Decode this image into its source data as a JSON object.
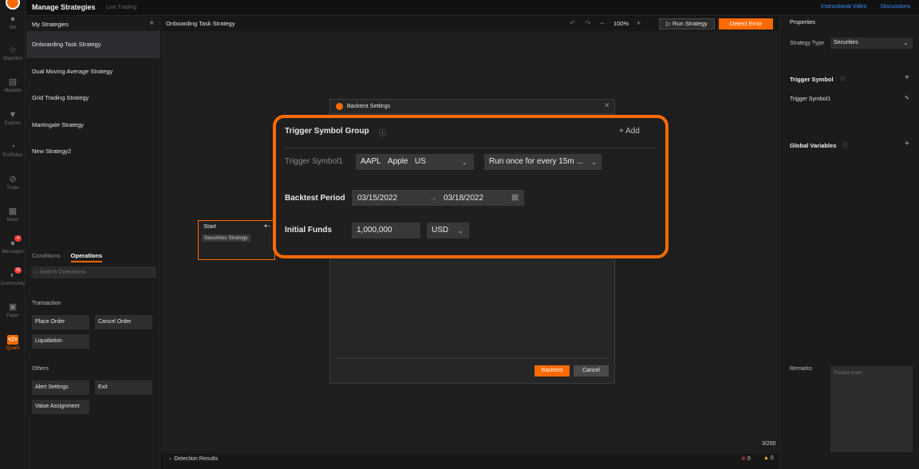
{
  "app": {
    "title": "Manage Strategies",
    "subtitle": "Live Trading"
  },
  "top_links": [
    "Instructional Video",
    "Discussions"
  ],
  "rail": [
    {
      "label": "Me",
      "icon": "user-icon",
      "glyph": "●"
    },
    {
      "label": "Watchlist",
      "icon": "watchlist-icon",
      "glyph": "☆"
    },
    {
      "label": "Markets",
      "icon": "markets-icon",
      "glyph": "▤"
    },
    {
      "label": "Explore",
      "icon": "explore-icon",
      "glyph": "▼"
    },
    {
      "label": "Portfolios",
      "icon": "portfolio-icon",
      "glyph": "◔"
    },
    {
      "label": "Trade",
      "icon": "trade-icon",
      "glyph": "⊘"
    },
    {
      "label": "News",
      "icon": "news-icon",
      "glyph": "▦"
    },
    {
      "label": "Messages",
      "icon": "messages-icon",
      "glyph": "●",
      "badge": "4"
    },
    {
      "label": "Community",
      "icon": "community-icon",
      "glyph": "◐",
      "badge": "15"
    },
    {
      "label": "Paper",
      "icon": "paper-icon",
      "glyph": "▣"
    },
    {
      "label": "Quant",
      "icon": "quant-icon",
      "glyph": "</>",
      "active": true
    }
  ],
  "strategies": {
    "header": "My Strategies",
    "items": [
      "Onboarding Task Strategy",
      "Dual Moving Average Strategy",
      "Grid Trading Strategy",
      "Martingale Strategy",
      "New Strategy2"
    ],
    "selected_index": 0
  },
  "ops": {
    "tabs": [
      "Conditions",
      "Operations"
    ],
    "active_tab": "Operations",
    "search_placeholder": "Search Operations",
    "transaction_title": "Transaction",
    "transaction_buttons": [
      "Place Order",
      "Cancel Order",
      "Liquidation"
    ],
    "others_title": "Others",
    "others_buttons": [
      "Alert Settings",
      "Exit",
      "Value Assignment"
    ]
  },
  "canvas": {
    "title": "Onboarding Task Strategy",
    "zoom": "100%",
    "run_label": "Run Strategy",
    "detect_label": "Detect Error",
    "start_label": "Start",
    "start_chip": "Securities Strategy",
    "detection_results": "Detection Results",
    "counter": "3/200",
    "error_count": "0",
    "warning_count": "0"
  },
  "dialog": {
    "title": "Backtest Settings",
    "backtest_label": "Backtest",
    "cancel_label": "Cancel"
  },
  "settings": {
    "trigger_group_title": "Trigger Symbol Group",
    "add_label": "Add",
    "trigger_symbol_label": "Trigger Symbol1",
    "symbol_ticker": "AAPL",
    "symbol_name": "Apple",
    "symbol_market": "US",
    "frequency": "Run once for every 15m ...",
    "backtest_period_label": "Backtest Period",
    "start_date": "03/15/2022",
    "end_date": "03/18/2022",
    "initial_funds_label": "Initial Funds",
    "initial_funds": "1,000,000",
    "currency": "USD"
  },
  "properties": {
    "title": "Properties",
    "strategy_type_label": "Strategy Type",
    "strategy_type_value": "Securities",
    "trigger_symbol_title": "Trigger Symbol",
    "trigger_symbol_item": "Trigger Symbol1",
    "global_variables_title": "Global Variables",
    "remarks_label": "Remarks",
    "remarks_placeholder": "Please enter"
  },
  "colors": {
    "accent": "#ff6a00",
    "link": "#3a8eff",
    "error": "#e83a3a",
    "warning": "#f3c316"
  }
}
